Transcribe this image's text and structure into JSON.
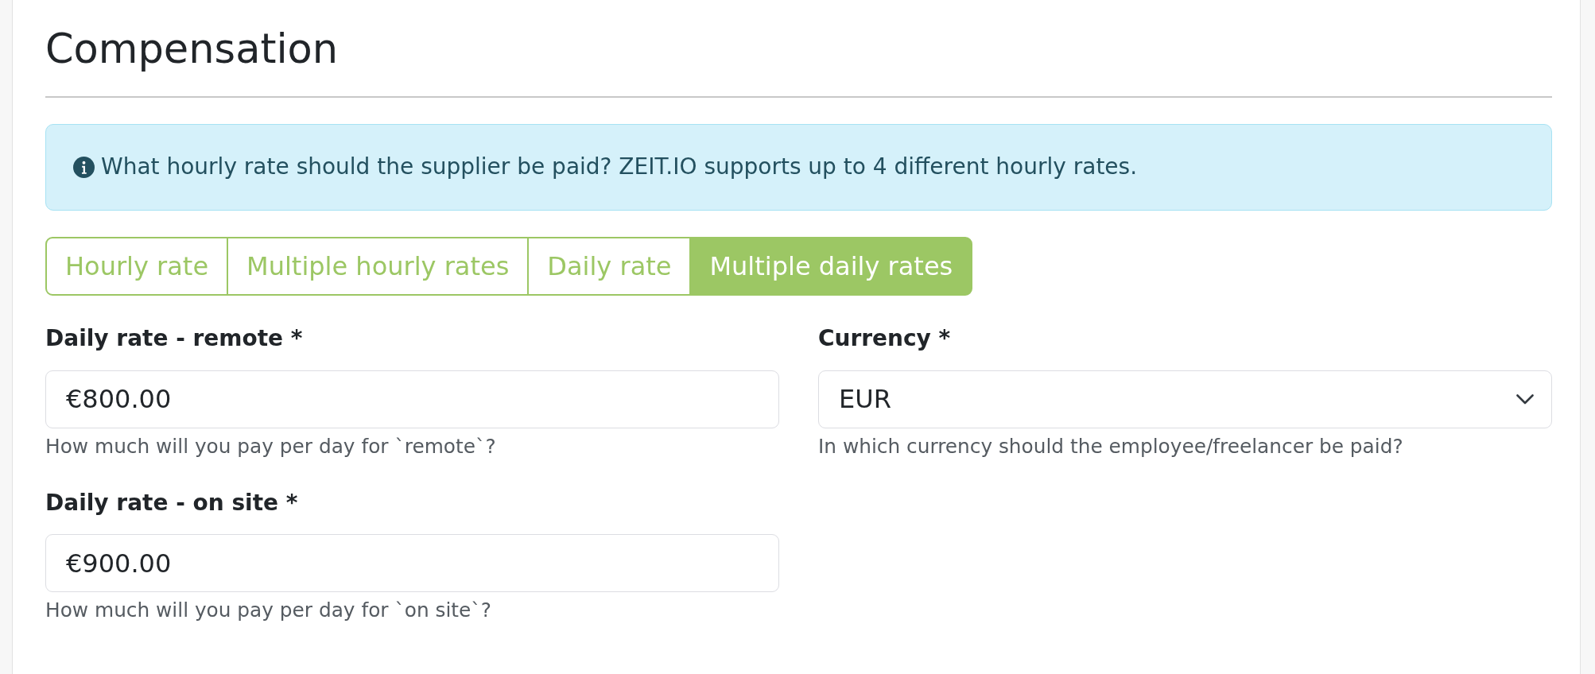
{
  "heading": "Compensation",
  "alert": {
    "text": "What hourly rate should the supplier be paid? ZEIT.IO supports up to 4 different hourly rates."
  },
  "rate_tabs": [
    {
      "label": "Hourly rate",
      "selected": false
    },
    {
      "label": "Multiple hourly rates",
      "selected": false
    },
    {
      "label": "Daily rate",
      "selected": false
    },
    {
      "label": "Multiple daily rates",
      "selected": true
    }
  ],
  "fields": [
    {
      "kind": "input",
      "label": "Daily rate - remote *",
      "value": "€800.00",
      "help": "How much will you pay per day for `remote`?"
    },
    {
      "kind": "select",
      "label": "Currency *",
      "value": "EUR",
      "help": "In which currency should the employee/freelancer be paid?"
    },
    {
      "kind": "input",
      "label": "Daily rate - on site *",
      "value": "€900.00",
      "help": "How much will you pay per day for `on site`?"
    }
  ]
}
